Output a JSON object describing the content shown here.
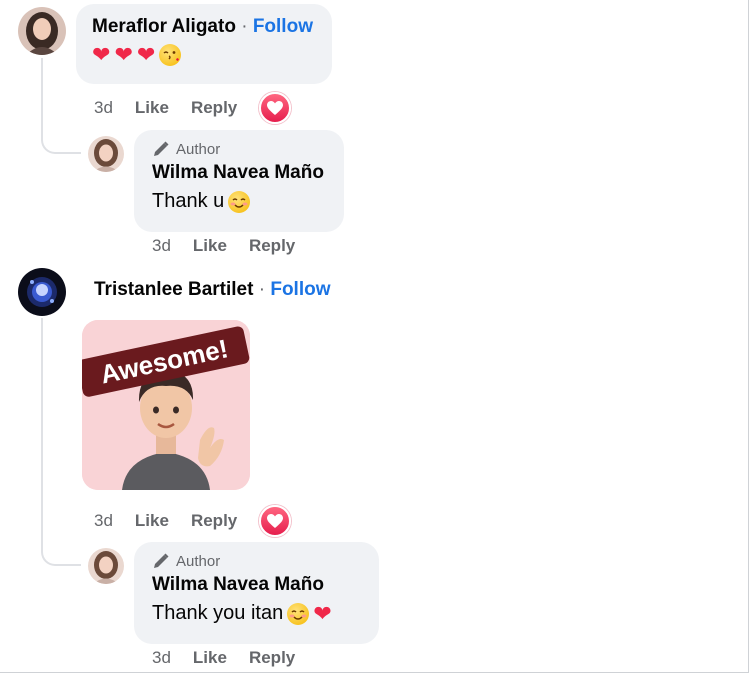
{
  "comments": [
    {
      "name": "Meraflor Aligato",
      "separator": "·",
      "follow_label": "Follow",
      "text_emojis": [
        "heart",
        "heart",
        "heart",
        "kiss-wink"
      ],
      "time": "3d",
      "like_label": "Like",
      "reply_label": "Reply",
      "reaction": "love"
    },
    {
      "reply": true,
      "author_badge": "Author",
      "name": "Wilma Navea Maño",
      "text": "Thank u",
      "text_emojis": [
        "smiling-face"
      ],
      "time": "3d",
      "like_label": "Like",
      "reply_label": "Reply"
    },
    {
      "name": "Tristanlee Bartilet",
      "separator": "·",
      "follow_label": "Follow",
      "sticker_text": "Awesome!",
      "time": "3d",
      "like_label": "Like",
      "reply_label": "Reply",
      "reaction": "love"
    },
    {
      "reply": true,
      "author_badge": "Author",
      "name": "Wilma Navea Maño",
      "text": "Thank you itan",
      "text_emojis": [
        "smiling-face",
        "heart"
      ],
      "time": "3d",
      "like_label": "Like",
      "reply_label": "Reply"
    }
  ],
  "colors": {
    "bubble": "#f0f2f5",
    "follow": "#1b74e4",
    "meta": "#65676b",
    "love": "#f02849"
  }
}
